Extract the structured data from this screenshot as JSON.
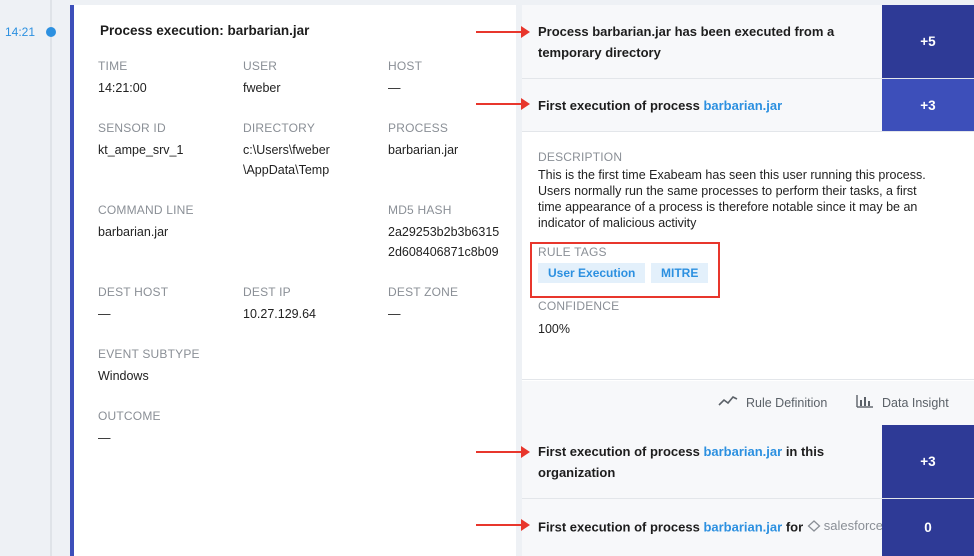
{
  "timeline": {
    "time": "14:21"
  },
  "event": {
    "title": "Process execution: barbarian.jar",
    "fields": [
      {
        "label": "TIME",
        "value": "14:21:00"
      },
      {
        "label": "USER",
        "value": "fweber"
      },
      {
        "label": "HOST",
        "value": "—"
      },
      {
        "label": "SENSOR ID",
        "value": "kt_ampe_srv_1"
      },
      {
        "label": "DIRECTORY",
        "value": "c:\\Users\\fweber\n\\AppData\\Temp"
      },
      {
        "label": "PROCESS",
        "value": "barbarian.jar"
      },
      {
        "label": "COMMAND LINE",
        "value": "barbarian.jar"
      },
      {
        "label": "MD5 HASH",
        "value": "2a29253b2b3b6315\n2d608406871c8b09"
      },
      {
        "label": "DEST HOST",
        "value": "—"
      },
      {
        "label": "DEST IP",
        "value": "10.27.129.64"
      },
      {
        "label": "DEST ZONE",
        "value": "—"
      },
      {
        "label": "EVENT SUBTYPE",
        "value": "Windows"
      },
      {
        "label": "OUTCOME",
        "value": "—"
      }
    ]
  },
  "rules": [
    {
      "prefix": "Process barbarian.jar has been executed from a temporary directory",
      "process": "",
      "suffix": "",
      "score": "+5",
      "score_color": "#2e3a96"
    },
    {
      "prefix": "First execution of process ",
      "process": "barbarian.jar",
      "suffix": "",
      "score": "+3",
      "score_color": "#3d4fba"
    },
    {
      "prefix": "First execution of process ",
      "process": "barbarian.jar",
      "suffix": " in this organization",
      "score": "+3",
      "score_color": "#2e3a96"
    },
    {
      "prefix": "First execution of process ",
      "process": "barbarian.jar",
      "suffix": " for ",
      "score": "0",
      "score_color": "#2e3a96"
    }
  ],
  "details": {
    "description_label": "DESCRIPTION",
    "description": "This is the first time Exabeam has seen this user running this process. Users normally run the same processes to perform their tasks, a first time appearance of a process is therefore notable since it may be an indicator of malicious activity",
    "rule_tags_label": "RULE TAGS",
    "tags": [
      "User Execution",
      "MITRE"
    ],
    "confidence_label": "CONFIDENCE",
    "confidence": "100%"
  },
  "actions": {
    "rule_definition": "Rule Definition",
    "data_insight": "Data Insight"
  },
  "salesforce_logo_text": "salesforce",
  "colors": {
    "accent": "#2c90e0",
    "card_border": "#3d4fba",
    "annotation": "#e8362c"
  }
}
